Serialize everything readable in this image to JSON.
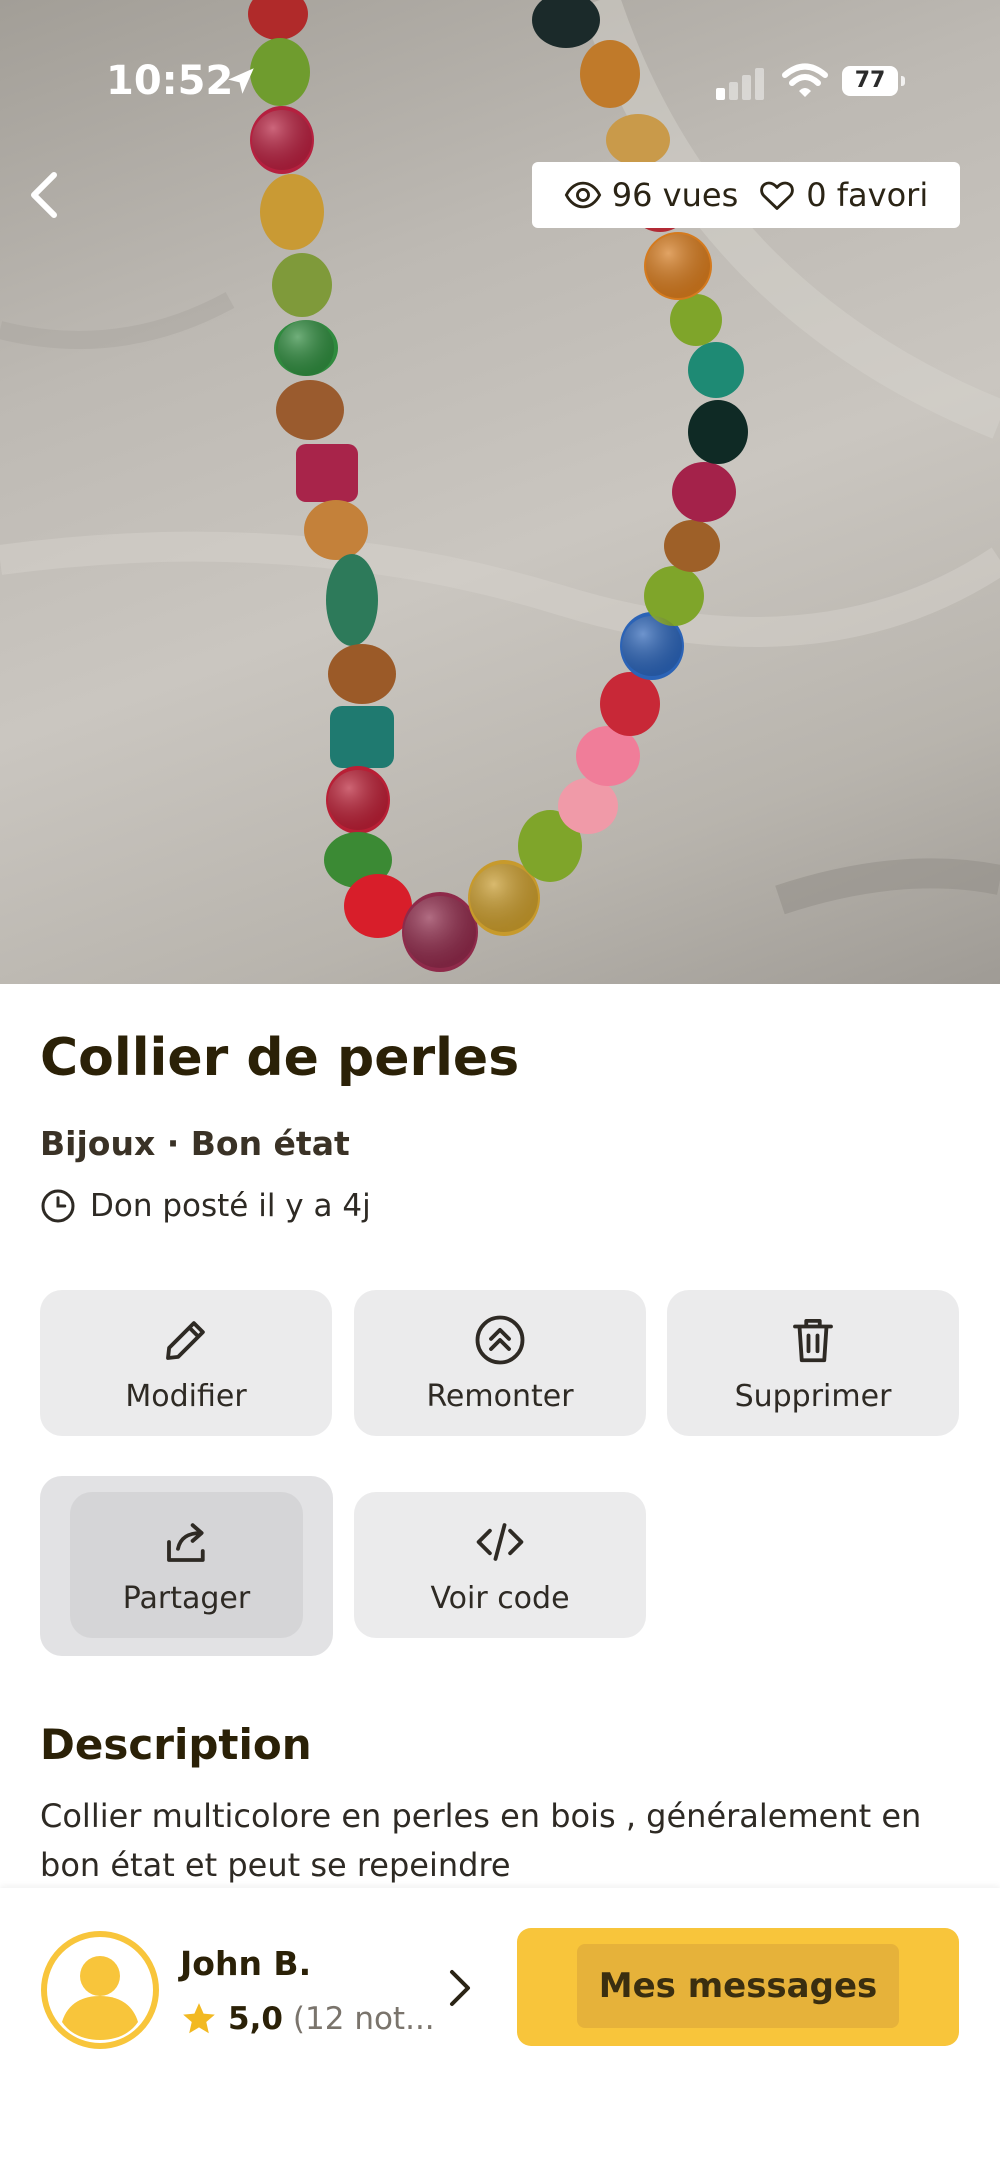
{
  "status_bar": {
    "time": "10:52",
    "battery": "77"
  },
  "header": {
    "views_label": "96 vues",
    "favorites_label": "0 favori"
  },
  "item": {
    "title": "Collier de perles",
    "category_condition": "Bijoux · Bon état",
    "posted": "Don posté il y a 4j"
  },
  "actions": {
    "edit_label": "Modifier",
    "bump_label": "Remonter",
    "delete_label": "Supprimer",
    "share_label": "Partager",
    "code_label": "Voir code"
  },
  "description": {
    "heading": "Description",
    "text": "Collier multicolore en perles en bois , généralement en bon état et peut se repeindre"
  },
  "seller": {
    "name": "John B.",
    "rating": "5,0",
    "rating_count": "(12 not..."
  },
  "bottom": {
    "messages_label": "Mes messages"
  },
  "colors": {
    "accent": "#f8c53b",
    "button_bg": "#ebebec",
    "title_text": "#2b2107"
  },
  "icons": [
    "location-arrow-icon",
    "signal-icon",
    "wifi-icon",
    "battery-icon",
    "back-chevron-icon",
    "eye-icon",
    "heart-icon",
    "clock-icon",
    "pencil-icon",
    "double-chevron-up-icon",
    "trash-icon",
    "share-icon",
    "code-icon",
    "user-avatar-icon",
    "star-icon",
    "chevron-right-icon"
  ]
}
